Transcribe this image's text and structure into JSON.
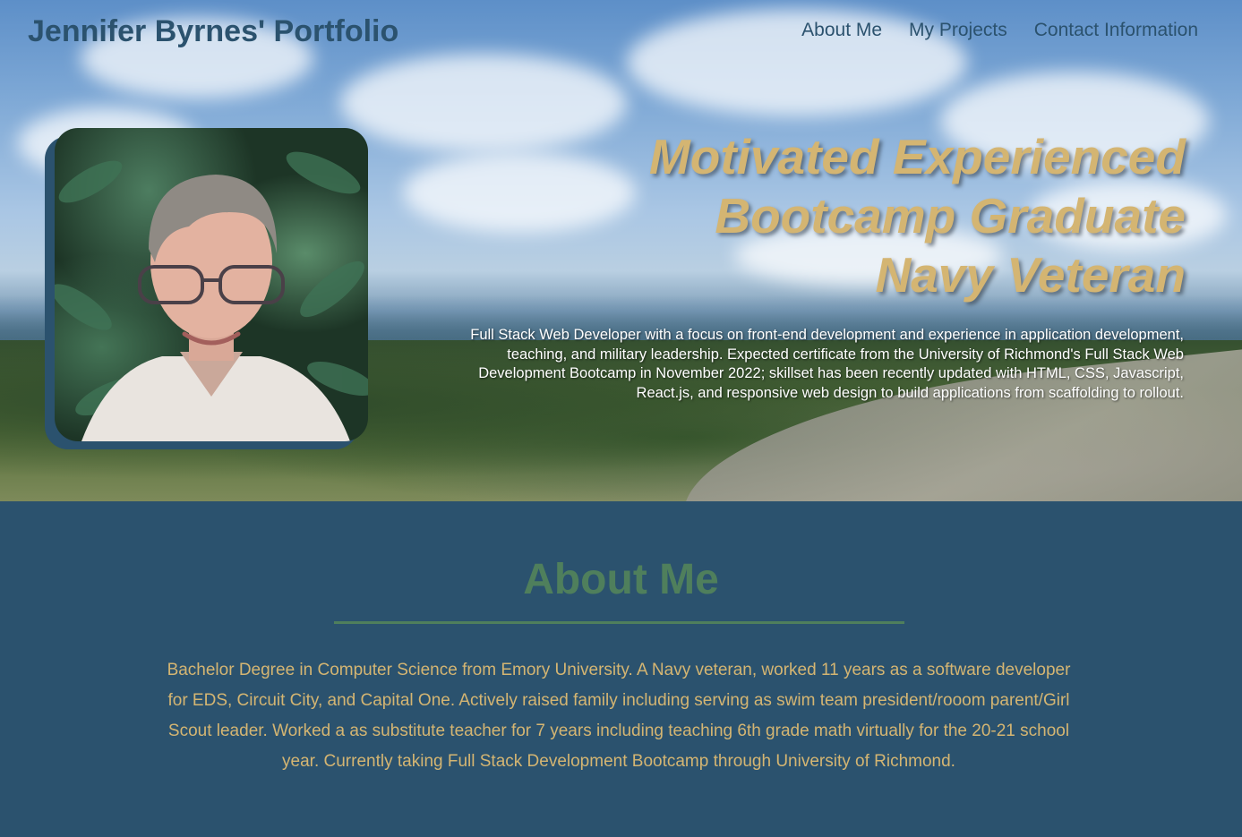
{
  "nav": {
    "brand": "Jennifer Byrnes' Portfolio",
    "links": [
      "About Me",
      "My Projects",
      "Contact Information"
    ]
  },
  "hero": {
    "headline": [
      "Motivated Experienced",
      "Bootcamp Graduate",
      "Navy Veteran"
    ],
    "summary": "Full Stack Web Developer with a focus on front-end development and experience in application development, teaching, and military leadership. Expected certificate from the University of Richmond's Full Stack Web Development Bootcamp in November 2022; skillset has been recently updated with HTML, CSS, Javascript, React.js, and responsive web design to build applications from scaffolding to rollout."
  },
  "about": {
    "title": "About Me",
    "text": "Bachelor Degree in Computer Science from Emory University. A Navy veteran, worked 11 years as a software developer for EDS, Circuit City, and Capital One. Actively raised family including serving as swim team president/rooom parent/Girl Scout leader. Worked a as substitute teacher for 7 years including teaching 6th grade math virtually for the 20-21 school year. Currently taking Full Stack Development Bootcamp through University of Richmond."
  },
  "colors": {
    "primary": "#2b526e",
    "gold": "#d4b572",
    "green": "#4f7f5c"
  }
}
